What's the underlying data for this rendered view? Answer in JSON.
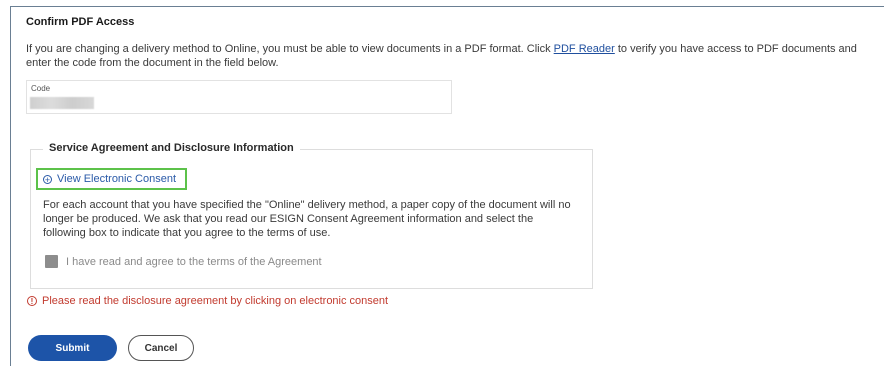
{
  "section": {
    "title": "Confirm PDF Access",
    "intro_before_link": "If you are changing a delivery method to Online, you must be able to view documents in a PDF format. Click ",
    "intro_link": "PDF Reader",
    "intro_after_link": " to verify you have access to PDF documents and enter the code from the document in the field below."
  },
  "code_field": {
    "label": "Code"
  },
  "agreement": {
    "legend": "Service Agreement and Disclosure Information",
    "consent_link": "View Electronic Consent",
    "consent_icon": "plus-circle-icon",
    "body": "For each account that you have specified the \"Online\" delivery method, a paper copy of the document will no longer be produced. We ask that you read our ESIGN Consent Agreement information and select the following box to indicate that you agree to the terms of use.",
    "checkbox_label": "I have read and agree to the terms of the Agreement",
    "checkbox_checked": false
  },
  "error": {
    "icon": "warning-circle-icon",
    "message": "Please read the disclosure agreement by clicking on electronic consent"
  },
  "actions": {
    "submit": "Submit",
    "cancel": "Cancel"
  },
  "colors": {
    "primary": "#1d54a8",
    "link": "#2a5aa8",
    "highlight": "#5cc24a",
    "error": "#c23b2f"
  }
}
